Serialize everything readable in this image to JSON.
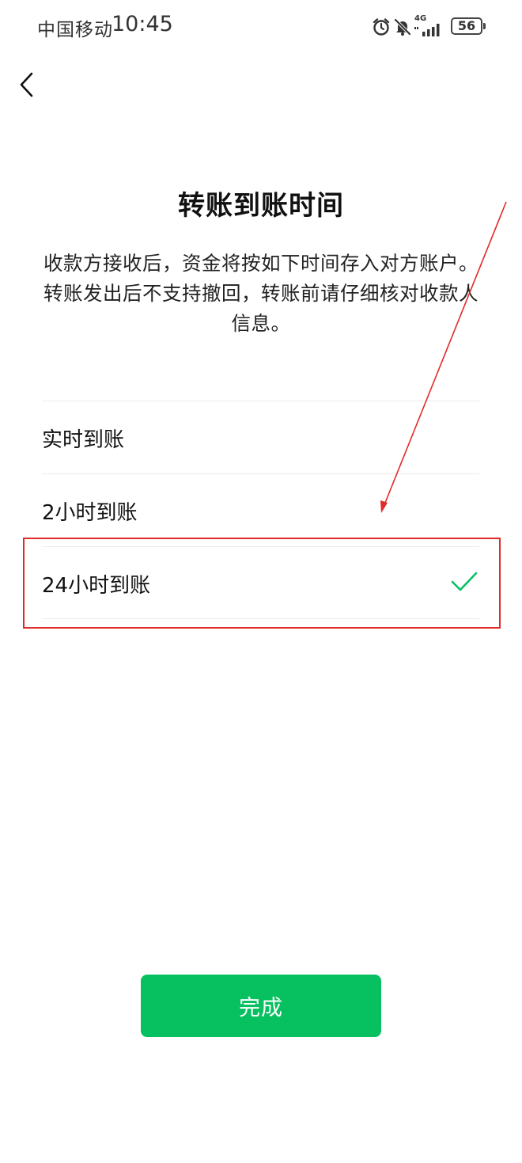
{
  "status_bar": {
    "carrier": "中国移动",
    "time": "10:45",
    "network": "4G",
    "battery": "56",
    "icons": [
      "alarm-icon",
      "mute-bell-icon",
      "signal-icon"
    ]
  },
  "nav": {
    "back_icon": "chevron-left-icon"
  },
  "page": {
    "title": "转账到账时间",
    "description": "收款方接收后，资金将按如下时间存入对方账户。转账发出后不支持撤回，转账前请仔细核对收款人信息。"
  },
  "options": [
    {
      "label": "实时到账",
      "selected": false
    },
    {
      "label": "2小时到账",
      "selected": false
    },
    {
      "label": "24小时到账",
      "selected": true
    }
  ],
  "colors": {
    "accent": "#07c160",
    "annotation": "#e12a2a"
  },
  "done_button": {
    "label": "完成"
  }
}
